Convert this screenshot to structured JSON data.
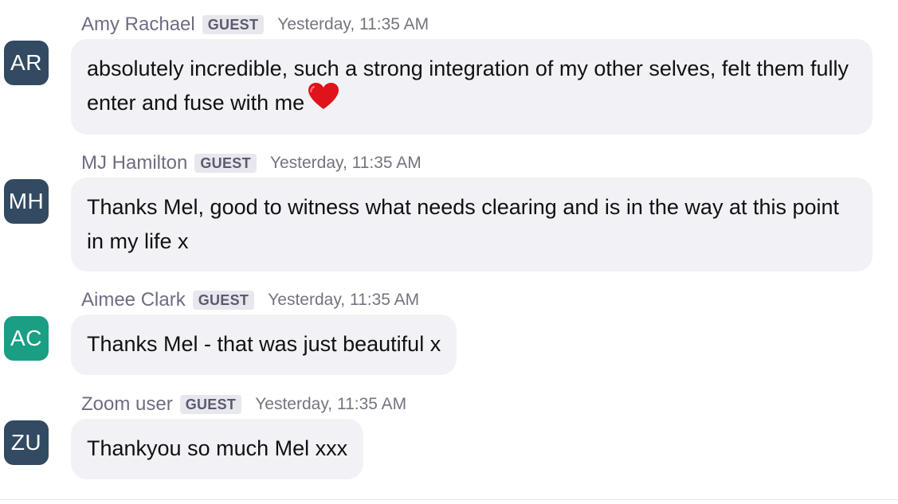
{
  "messages": [
    {
      "initials": "AR",
      "avatar_color": "#324a62",
      "name": "Amy Rachael",
      "badge": "GUEST",
      "time": "Yesterday, 11:35 AM",
      "text": "absolutely incredible, such a strong integration of my other selves, felt them fully enter and fuse with me",
      "emoji": "heart"
    },
    {
      "initials": "MH",
      "avatar_color": "#324a62",
      "name": "MJ Hamilton",
      "badge": "GUEST",
      "time": "Yesterday, 11:35 AM",
      "text": "Thanks Mel, good to witness what needs clearing and is in the way at this point in my life x"
    },
    {
      "initials": "AC",
      "avatar_color": "#1a9e84",
      "name": "Aimee Clark",
      "badge": "GUEST",
      "time": "Yesterday, 11:35 AM",
      "text": "Thanks Mel - that was just beautiful x"
    },
    {
      "initials": "ZU",
      "avatar_color": "#324a62",
      "name": "Zoom user",
      "badge": "GUEST",
      "time": "Yesterday, 11:35 AM",
      "text": "Thankyou so much Mel xxx"
    }
  ]
}
